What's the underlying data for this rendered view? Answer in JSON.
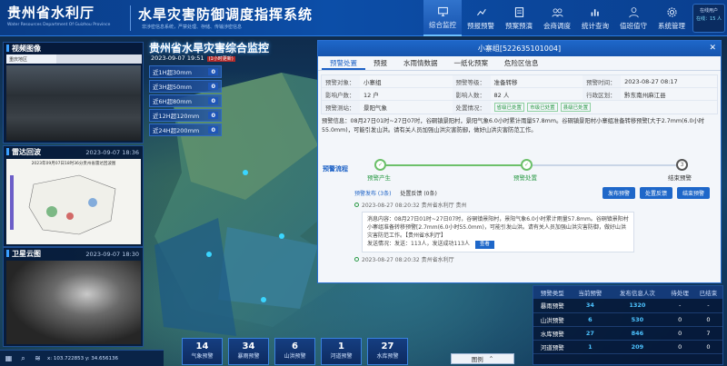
{
  "header": {
    "org_title": "贵州省水利厅",
    "org_en": "Water Resources Department Of Guizhou Province",
    "system_title": "水旱灾害防御调度指挥系统",
    "system_sub": "非涉密信息系统，严禁处理、存储、传输涉密信息",
    "nav": [
      {
        "label": "综合监控",
        "icon": "monitor-icon",
        "active": true
      },
      {
        "label": "预报预警",
        "icon": "forecast-icon"
      },
      {
        "label": "预案预演",
        "icon": "plan-icon"
      },
      {
        "label": "会商调度",
        "icon": "consult-icon"
      },
      {
        "label": "统计查询",
        "icon": "stats-icon"
      },
      {
        "label": "值班值守",
        "icon": "duty-icon"
      },
      {
        "label": "系统管理",
        "icon": "settings-icon"
      }
    ],
    "online_label": "在线用户",
    "online_count": "在线：15 人"
  },
  "left": {
    "video_title": "视频图像",
    "video_select": "重庆地区",
    "radar_title": "雷达回波",
    "radar_time": "2023-09-07 18:36",
    "radar_caption": "2023年09月07日18时36分贵州省雷达回波图",
    "sat_title": "卫星云图",
    "sat_time": "2023-09-07 18:30"
  },
  "monitor": {
    "title": "贵州省水旱灾害综合监控",
    "date": "2023-09-07 19:51",
    "date_badge": "(1小时更新)",
    "rain": [
      {
        "label": "近1H超30mm",
        "value": "0"
      },
      {
        "label": "近3H超50mm",
        "value": "0"
      },
      {
        "label": "近6H超80mm",
        "value": "0"
      },
      {
        "label": "近12H超120mm",
        "value": "0"
      },
      {
        "label": "近24H超200mm",
        "value": "0"
      }
    ]
  },
  "popup": {
    "title": "小寨组[522635101004]",
    "close": "✕",
    "tabs": [
      "预警处置",
      "预报",
      "水雨情数据",
      "一纸化预案",
      "危险区信息"
    ],
    "fields": {
      "target_label": "预警对象：",
      "target": "小寨组",
      "level_label": "预警等级：",
      "level": "准备转移",
      "time_label": "预警时间：",
      "time": "2023-08-27 08:17",
      "households_label": "影响户数：",
      "households": "12 户",
      "people_label": "影响人数：",
      "people": "82 人",
      "region_label": "行政区划：",
      "region": "黔东南州麻江县",
      "station_label": "预警测站：",
      "station": "景阳气象",
      "status_label": "处置情况：",
      "status_tags": [
        "省级已处置",
        "市级已处置",
        "县级已处置"
      ]
    },
    "info": "预警信息：08月27日01时~27日07时，谷硐镇景阳村，景阳气象6.0小时累计雨量57.8mm。谷硐镇景阳村小寨组准备转移预警[大于2.7mm(6.0小时55.0mm)，可能引发山洪。请有关人员加强山洪灾害防御，做好山洪灾害防范工作。",
    "flow_title": "预警流程",
    "steps": [
      "预警产生",
      "预警处置",
      "结束预警"
    ],
    "subtabs": [
      "预警发布 (3条)",
      "处置反馈 (0条)"
    ],
    "buttons": [
      "发布预警",
      "处置反馈",
      "结束预警"
    ],
    "timeline": [
      {
        "time": "2023-08-27 08:20:32 贵州省水利厅 贵州"
      },
      {
        "time": "2023-08-27 08:20:32 贵州省水利厅"
      }
    ],
    "message": "消息内容：08月27日01时~27日07时，谷硐镇景阳村，景阳气象6.0小时累计雨量57.8mm。谷硐镇景阳村小寨组准备转移预警[2.7mm(6.0小时55.0mm)，可能引发山洪。请有关人员加强山洪灾害防御，做好山洪灾害防范工作。【贵州省水利厅】",
    "message_send": "发送情况：发送：113人，发送成功113人",
    "message_btn": "查看"
  },
  "stats": {
    "headers": [
      "预警类型",
      "当前预警",
      "发布信息人次",
      "待处理",
      "已结束"
    ],
    "rows": [
      [
        "暴雨预警",
        "34",
        "1320",
        "-",
        "-"
      ],
      [
        "山洪预警",
        "6",
        "530",
        "0",
        "0"
      ],
      [
        "水库预警",
        "27",
        "846",
        "0",
        "7"
      ],
      [
        "河道预警",
        "1",
        "209",
        "0",
        "0"
      ]
    ]
  },
  "bottom": {
    "coords": "x: 103.722853  y: 34.656136",
    "warn_cards": [
      {
        "num": "14",
        "label": "气象预警"
      },
      {
        "num": "34",
        "label": "暴雨预警"
      },
      {
        "num": "6",
        "label": "山洪预警"
      },
      {
        "num": "1",
        "label": "河道预警"
      },
      {
        "num": "27",
        "label": "水库预警"
      }
    ],
    "legend": "图例",
    "legend_icon": "up-chevron-icon"
  }
}
